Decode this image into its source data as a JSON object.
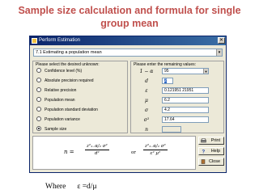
{
  "slide": {
    "title_line1": "Sample size calculation and formula for single",
    "title_line2": "group mean",
    "where_label": "Where",
    "where_formula": "ε =d/μ"
  },
  "window": {
    "title": "Perform Estimation",
    "close_label": "✕"
  },
  "topic_select": {
    "value": "7.1   Estimating a population mean",
    "arrow": "▾"
  },
  "unknown_group": {
    "label": "Please select the desired unknown:",
    "options": [
      {
        "label": "Confidence level (%)",
        "selected": false
      },
      {
        "label": "Absolute precision required",
        "selected": false
      },
      {
        "label": "Relative precision",
        "selected": false
      },
      {
        "label": "Population mean",
        "selected": false
      },
      {
        "label": "Population standard deviation",
        "selected": false
      },
      {
        "label": "Population variance",
        "selected": false
      },
      {
        "label": "Sample size",
        "selected": true
      }
    ]
  },
  "values_group": {
    "label": "Please enter the remaining values:",
    "params": [
      {
        "symbol": "1 − α",
        "value": "95",
        "has_arrow": true
      },
      {
        "symbol": "d",
        "value": "2",
        "selected": true
      },
      {
        "symbol": "ε",
        "value": "0.121951 21951"
      },
      {
        "symbol": "μ",
        "value": "6.2"
      },
      {
        "symbol": "σ",
        "value": "4.2"
      },
      {
        "symbol": "σ²",
        "value": "17.64"
      },
      {
        "symbol": "n",
        "value": "",
        "disabled": true
      }
    ]
  },
  "formula": {
    "lhs": "n =",
    "frac1_num": "z²₁₋α/₂ σ²",
    "frac1_den": "d²",
    "or": "or",
    "frac2_num": "z²₁₋α/₂ σ²",
    "frac2_den": "ε² μ²"
  },
  "buttons": {
    "print": "Print",
    "help": "Help",
    "close": "Close"
  }
}
